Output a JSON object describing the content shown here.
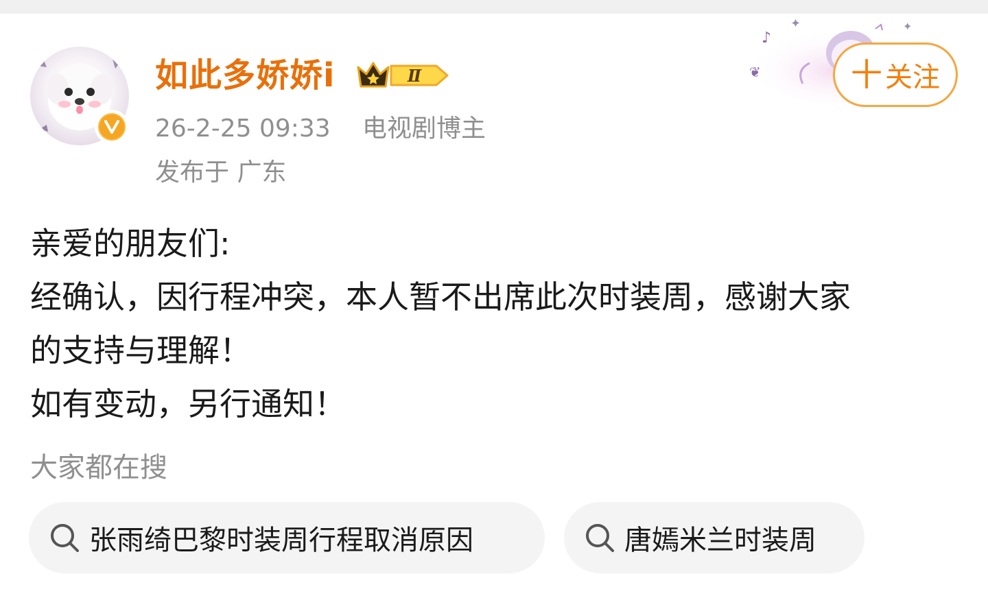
{
  "user": {
    "name": "如此多娇娇i",
    "rank_badge": "Ⅱ",
    "avatar_icon": "puppy-avatar",
    "verified_icon": "v-verified-icon"
  },
  "meta": {
    "time": "26-2-25 09:33",
    "category": "电视剧博主",
    "location": "发布于 广东"
  },
  "follow": {
    "label": "关注",
    "plus": "十",
    "accent": "#f57f0b",
    "border": "#f6a640"
  },
  "post": {
    "lines": [
      "亲爱的朋友们:",
      "经确认，因行程冲突，本人暂不出席此次时装周，感谢大家",
      "的支持与理解！",
      "如有变动，另行通知！"
    ]
  },
  "search": {
    "heading": "大家都在搜",
    "chips": [
      {
        "label": "张雨绮巴黎时装周行程取消原因",
        "icon": "search-icon"
      },
      {
        "label": "唐嫣米兰时装周",
        "icon": "search-icon"
      }
    ]
  },
  "colors": {
    "username": "#e8700a",
    "meta": "#8f8f8f",
    "text": "#1a1a1a",
    "chip_bg": "#f4f4f4"
  }
}
